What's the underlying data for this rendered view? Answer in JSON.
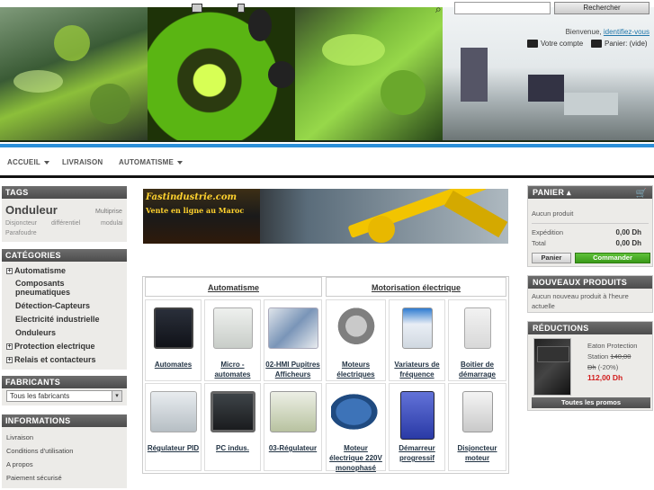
{
  "header": {
    "search_placeholder": "",
    "search_button": "Rechercher",
    "welcome_text": "Bienvenue,",
    "welcome_link": "identifiez-vous",
    "account_link": "Votre compte",
    "cart_link": "Panier:",
    "cart_status": "(vide)"
  },
  "nav": {
    "items": [
      {
        "label": "ACCUEIL",
        "has_dropdown": true
      },
      {
        "label": "LIVRAISON",
        "has_dropdown": false
      },
      {
        "label": "AUTOMATISME",
        "has_dropdown": true
      }
    ]
  },
  "left": {
    "tags": {
      "title": "TAGS",
      "items": [
        "Onduleur",
        "Multiprise",
        "Disjoncteur",
        "différentiel",
        "modulai",
        "Parafoudre"
      ]
    },
    "categories": {
      "title": "CATÉGORIES",
      "items": [
        {
          "label": "Automatisme",
          "expandable": true
        },
        {
          "label": "Composants pneumatiques",
          "expandable": false
        },
        {
          "label": "Détection-Capteurs",
          "expandable": false
        },
        {
          "label": "Electricité industrielle",
          "expandable": false
        },
        {
          "label": "Onduleurs",
          "expandable": false
        },
        {
          "label": "Protection electrique",
          "expandable": true
        },
        {
          "label": "Relais et contacteurs",
          "expandable": true
        }
      ]
    },
    "manufacturers": {
      "title": "FABRICANTS",
      "selected": "Tous les fabricants"
    },
    "informations": {
      "title": "INFORMATIONS",
      "items": [
        "Livraison",
        "Conditions d'utilisation",
        "A propos",
        "Paiement sécurisé"
      ]
    }
  },
  "promo_banner": {
    "title": "Fastindustrie.com",
    "subtitle": "Vente en ligne au Maroc"
  },
  "grid": {
    "headers": [
      "Automatisme",
      "Motorisation électrique"
    ],
    "row1": [
      "Automates",
      "Micro - automates",
      "02-HMI Pupitres Afficheurs",
      "Moteurs électriques",
      "Variateurs de fréquence",
      "Boitier de démarrage"
    ],
    "row2": [
      "Régulateur PID",
      "PC indus.",
      "03-Régulateur",
      "Moteur électrique 220V monophasé",
      "Démarreur progressif",
      "Disjoncteur moteur"
    ]
  },
  "right": {
    "cart": {
      "title": "PANIER",
      "empty_text": "Aucun produit",
      "shipping_label": "Expédition",
      "shipping_value": "0,00 Dh",
      "total_label": "Total",
      "total_value": "0,00 Dh",
      "btn_cart": "Panier",
      "btn_order": "Commander"
    },
    "new_products": {
      "title": "NOUVEAUX PRODUITS",
      "text": "Aucun nouveau produit à l'heure actuelle"
    },
    "reductions": {
      "title": "RÉDUCTIONS",
      "product_line1": "Eaton Protection",
      "product_line2": "Station",
      "old_price": "140,00",
      "old_price_unit": "Dh",
      "discount": "(-20%)",
      "new_price": "112,00 Dh",
      "btn_promos": "Toutes les promos"
    }
  },
  "colors": {
    "accent_blue": "#2b8fd8",
    "order_green": "#3a9a18",
    "price_red": "#d21e1e"
  }
}
